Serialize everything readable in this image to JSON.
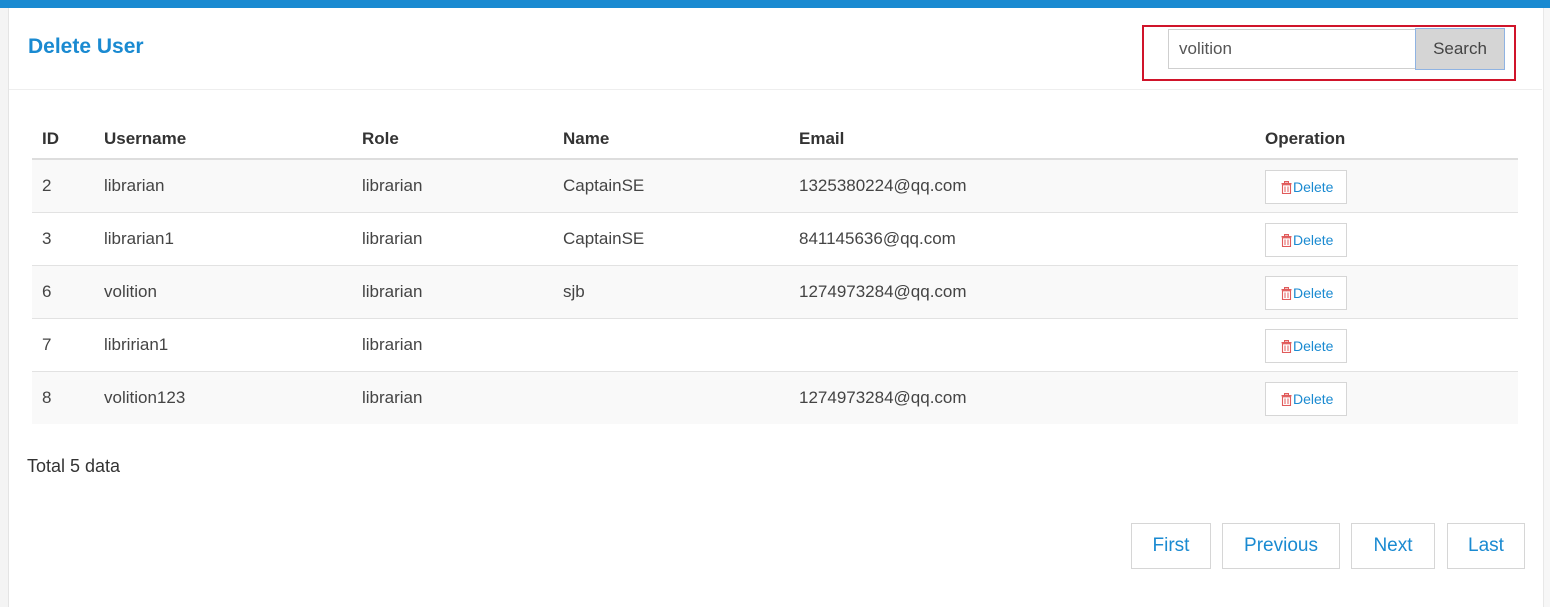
{
  "page": {
    "title": "Delete User",
    "accent_color": "#1a8ad1",
    "highlight_border_color": "#d0142a"
  },
  "search": {
    "value": "volition",
    "button_label": "Search"
  },
  "table": {
    "columns": [
      "ID",
      "Username",
      "Role",
      "Name",
      "Email",
      "Operation"
    ],
    "rows": [
      {
        "id": "2",
        "username": "librarian",
        "role": "librarian",
        "name": "CaptainSE",
        "email": "1325380224@qq.com",
        "action": "Delete"
      },
      {
        "id": "3",
        "username": "librarian1",
        "role": "librarian",
        "name": "CaptainSE",
        "email": "841145636@qq.com",
        "action": "Delete"
      },
      {
        "id": "6",
        "username": "volition",
        "role": "librarian",
        "name": "sjb",
        "email": "1274973284@qq.com",
        "action": "Delete"
      },
      {
        "id": "7",
        "username": "libririan1",
        "role": "librarian",
        "name": "",
        "email": "",
        "action": "Delete"
      },
      {
        "id": "8",
        "username": "volition123",
        "role": "librarian",
        "name": "",
        "email": "1274973284@qq.com",
        "action": "Delete"
      }
    ],
    "row_action_icon": "trash-icon"
  },
  "footer": {
    "total_text": "Total 5 data"
  },
  "pagination": {
    "first": "First",
    "previous": "Previous",
    "next": "Next",
    "last": "Last"
  }
}
